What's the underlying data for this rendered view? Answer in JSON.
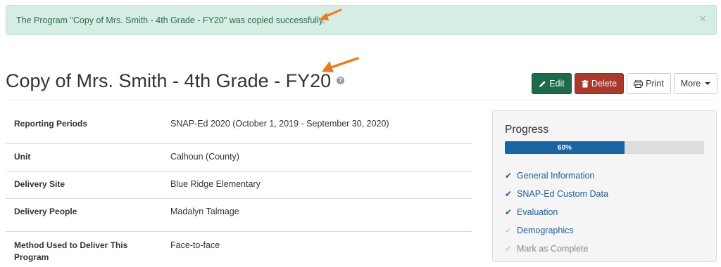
{
  "alert": {
    "message": "The Program \"Copy of Mrs. Smith - 4th Grade - FY20\" was copied successfully.",
    "close": "×"
  },
  "page": {
    "title": "Copy of Mrs. Smith - 4th Grade - FY20",
    "help_icon": "?"
  },
  "toolbar": {
    "edit_label": "Edit",
    "delete_label": "Delete",
    "print_label": "Print",
    "more_label": "More"
  },
  "details": [
    {
      "label": "Reporting Periods",
      "value": "SNAP-Ed 2020 (October 1, 2019 - September 30, 2020)"
    },
    {
      "label": "Unit",
      "value": "Calhoun (County)"
    },
    {
      "label": "Delivery Site",
      "value": "Blue Ridge Elementary"
    },
    {
      "label": "Delivery People",
      "value": "Madalyn Talmage"
    },
    {
      "label": "Method Used to Deliver This Program",
      "value": "Face-to-face"
    }
  ],
  "progress": {
    "title": "Progress",
    "percent": 60,
    "percent_label": "60%",
    "steps": [
      {
        "label": "General Information",
        "status": "done"
      },
      {
        "label": "SNAP-Ed Custom Data",
        "status": "done"
      },
      {
        "label": "Evaluation",
        "status": "done"
      },
      {
        "label": "Demographics",
        "status": "pending-link"
      },
      {
        "label": "Mark as Complete",
        "status": "pending"
      }
    ]
  },
  "colors": {
    "alert_bg": "#d5eee3",
    "edit": "#1d6b4a",
    "delete": "#a83a2b",
    "progress": "#1a64a2",
    "annotation_arrow": "#f07a1a"
  },
  "icons": {
    "edit": "pencil-icon",
    "delete": "trash-icon",
    "print": "printer-icon",
    "more": "caret-down-icon",
    "step": "check-icon"
  }
}
